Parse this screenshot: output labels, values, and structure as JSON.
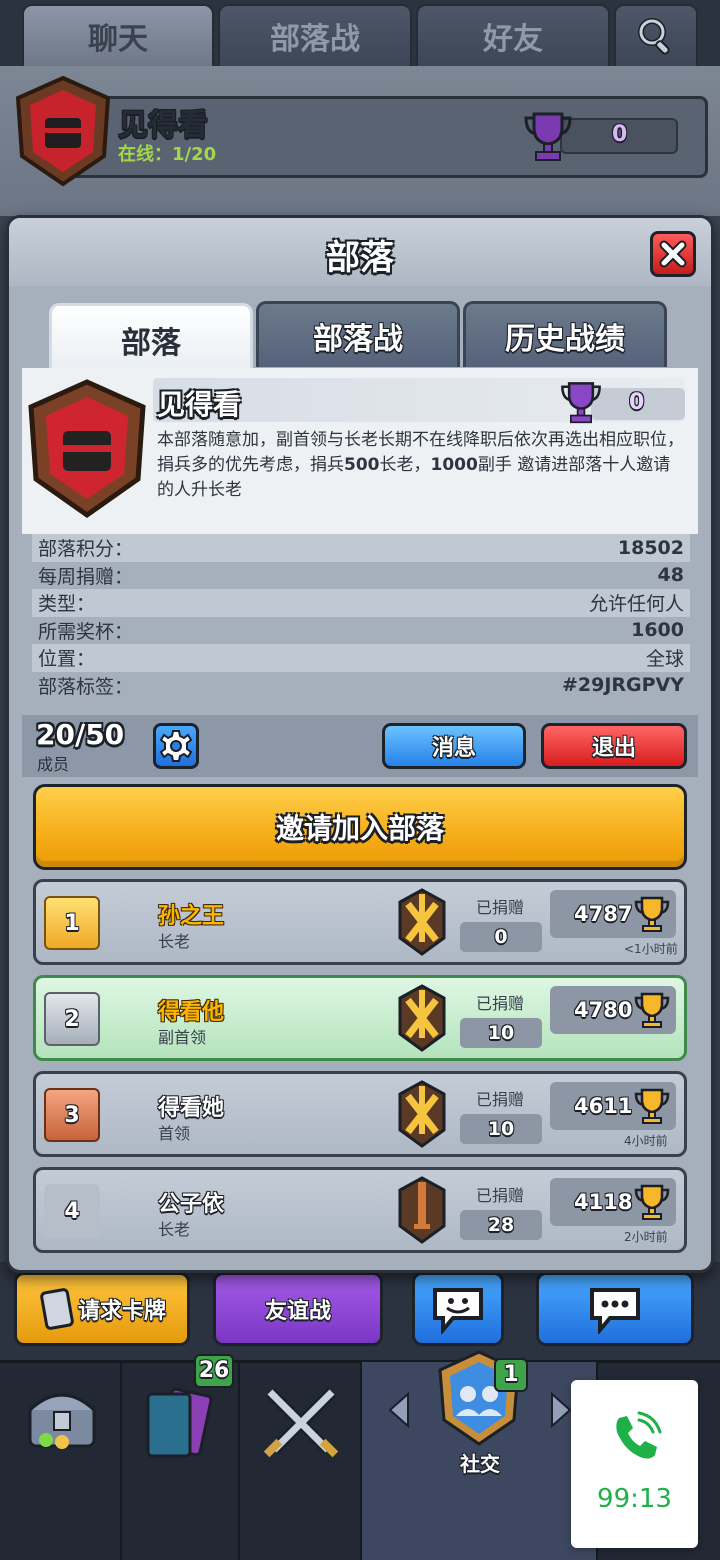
{
  "top_tabs": [
    "聊天",
    "部落战",
    "好友"
  ],
  "background_clan": {
    "name": "见得看",
    "online": "在线：1/20",
    "trophies": "0"
  },
  "modal": {
    "title": "部落",
    "tabs": [
      "部落",
      "部落战",
      "历史战绩"
    ],
    "clan": {
      "name": "见得看",
      "trophies": "0",
      "description_parts": [
        "本部落随意加，副首领与长老长期不在线降职后依次再选出相应职位，捐兵多的优先考虑，捐兵",
        "500",
        "长老，",
        "1000",
        "副手 邀请进部落十人邀请的人升长老"
      ]
    },
    "stats": [
      {
        "label": "部落积分：",
        "value": "18502"
      },
      {
        "label": "每周捐赠：",
        "value": "48"
      },
      {
        "label": "类型：",
        "value": "允许任何人"
      },
      {
        "label": "所需奖杯：",
        "value": "1600"
      },
      {
        "label": "位置：",
        "value": "全球"
      },
      {
        "label": "部落标签：",
        "value": "#29JRGPVY"
      }
    ],
    "member_count": "20/50",
    "member_label": "成员",
    "message_button": "消息",
    "exit_button": "退出",
    "invite_button": "邀请加入部落",
    "members": [
      {
        "rank": "1",
        "name": "孙之王",
        "role": "长老",
        "donated_label": "已捐赠",
        "donated": "0",
        "trophies": "4787",
        "last_seen": "<1小时前"
      },
      {
        "rank": "2",
        "name": "得看他",
        "role": "副首领",
        "donated_label": "已捐赠",
        "donated": "10",
        "trophies": "4780",
        "last_seen": ""
      },
      {
        "rank": "3",
        "name": "得看她",
        "role": "首领",
        "donated_label": "已捐赠",
        "donated": "10",
        "trophies": "4611",
        "last_seen": "4小时前"
      },
      {
        "rank": "4",
        "name": "公子依",
        "role": "长老",
        "donated_label": "已捐赠",
        "donated": "28",
        "trophies": "4118",
        "last_seen": "2小时前"
      }
    ]
  },
  "bottom_buttons": {
    "request_cards": "请求卡牌",
    "friendly_battle": "友谊战"
  },
  "nav": {
    "cards_badge": "26",
    "social_badge": "1",
    "social_label": "社交"
  },
  "call_widget": {
    "timer": "99:13"
  },
  "colors": {
    "accent_orange": "#f4a812",
    "message_blue": "#2582e8",
    "exit_red": "#d81e1e",
    "call_green": "#1fb148"
  }
}
